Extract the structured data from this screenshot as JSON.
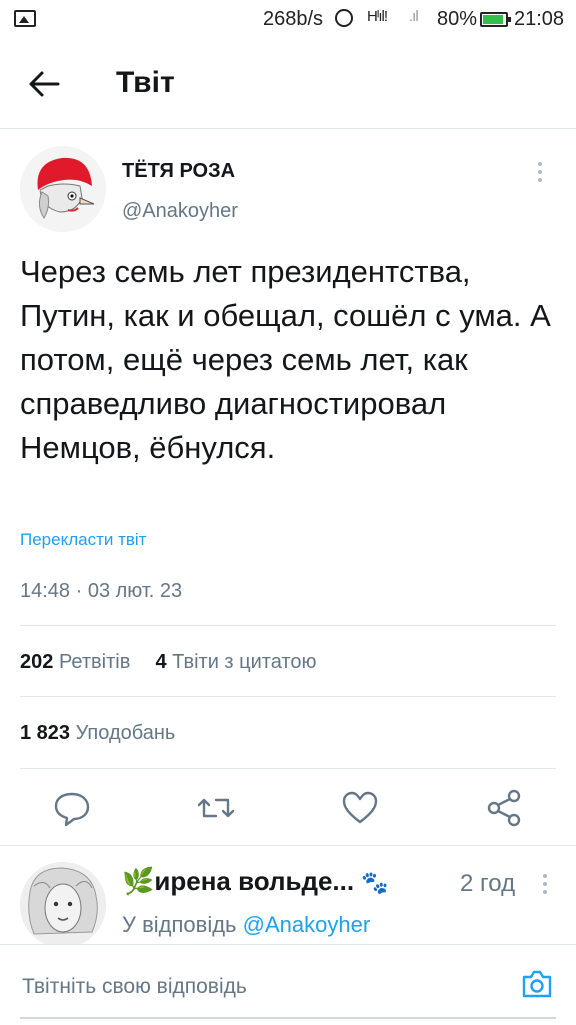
{
  "status_bar": {
    "network_speed": "268b/s",
    "signal1": "Hᴵıl!",
    "signal2": ".ıl",
    "battery": "80%",
    "battery_level": 0.8,
    "time": "21:08"
  },
  "header": {
    "title": "Твіт"
  },
  "tweet": {
    "author_name": "ТЁТЯ РОЗА",
    "author_handle": "@Anakoyher",
    "text": "Через семь лет президентства, Путин, как и обещал, сошёл с ума. А потом, ещё через семь лет, как справедливо диагностировал Немцов, ёбнулся.",
    "translate_label": "Перекласти твіт",
    "datetime": "14:48 · 03 лют. 23",
    "retweets_count": "202",
    "retweets_label": "Ретвітів",
    "quotes_count": "4",
    "quotes_label": "Твіти з цитатою",
    "likes_count": "1 823",
    "likes_label": "Уподобань"
  },
  "reply": {
    "author_name": "🌿ирена вольде...",
    "emoji_tail": "🐾",
    "time": "2 год",
    "reply_to_prefix": "У відповідь",
    "reply_to_handle": "@Anakoyher"
  },
  "compose": {
    "placeholder": "Твітніть свою відповідь"
  },
  "colors": {
    "accent": "#1da1f2",
    "secondary_text": "#657786",
    "divider": "#e1e8ed"
  }
}
